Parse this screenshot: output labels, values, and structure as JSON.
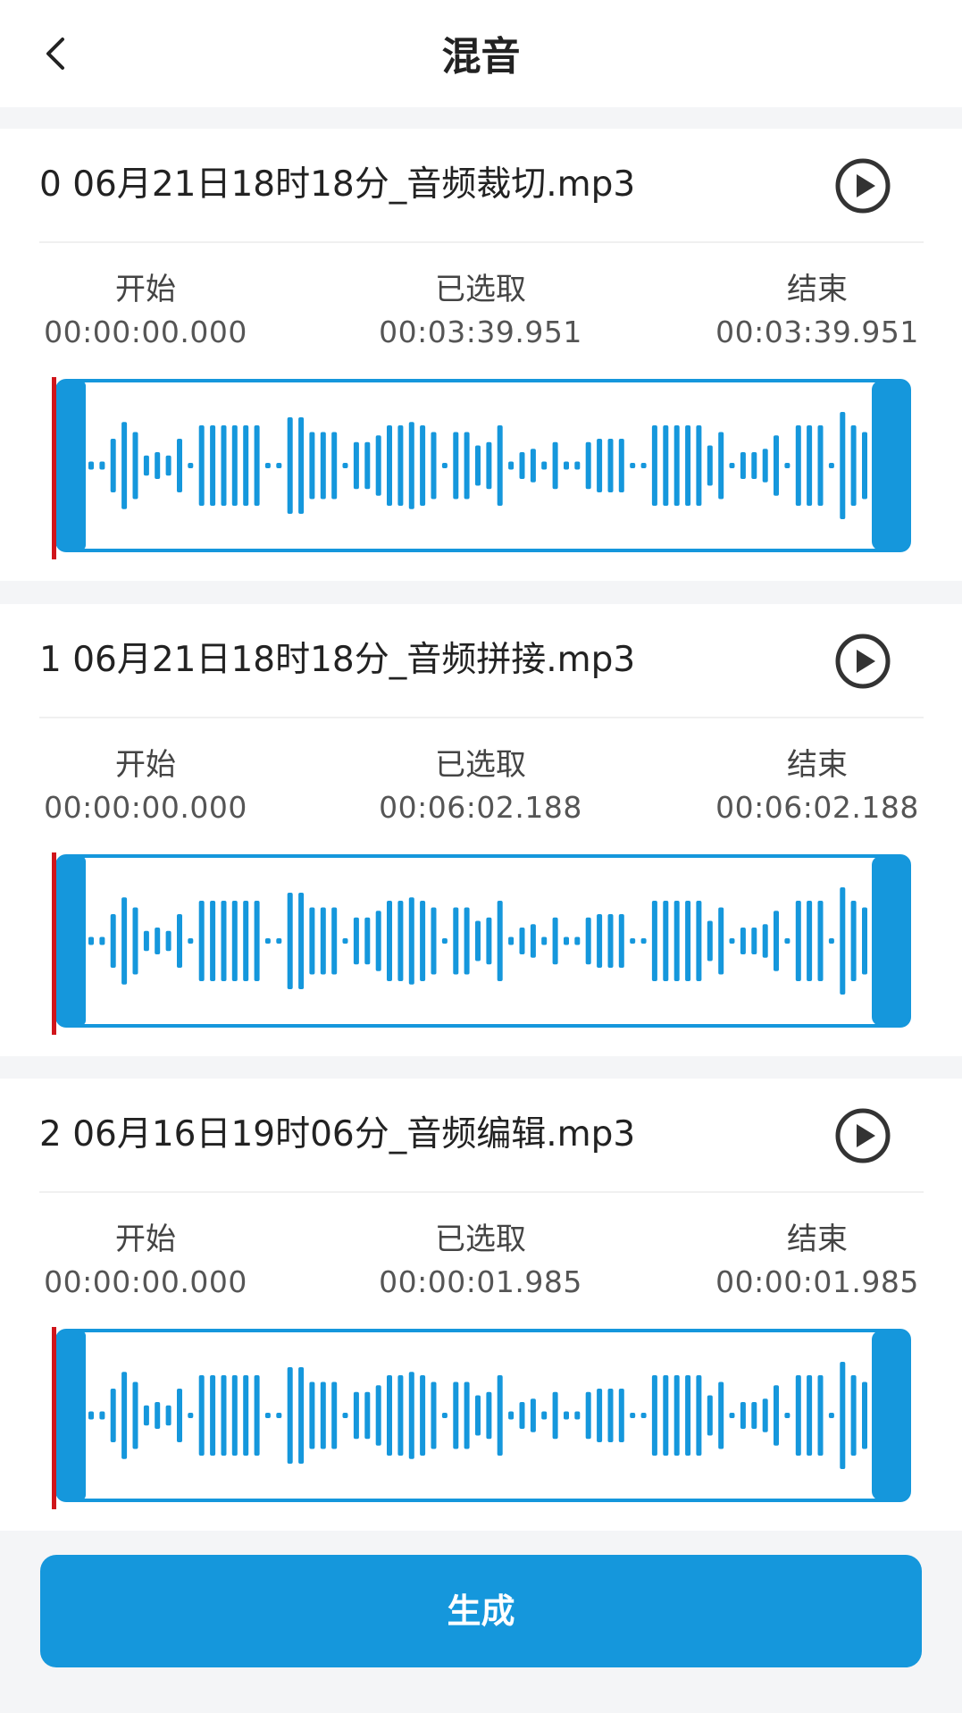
{
  "header": {
    "title": "混音",
    "back_icon": "chevron-left-icon"
  },
  "labels": {
    "start": "开始",
    "selected": "已选取",
    "end": "结束"
  },
  "tracks": [
    {
      "name": "0  06月21日18时18分_音频裁切.mp3",
      "start": "00:00:00.000",
      "selected": "00:03:39.951",
      "end": "00:03:39.951"
    },
    {
      "name": "1  06月21日18时18分_音频拼接.mp3",
      "start": "00:00:00.000",
      "selected": "00:06:02.188",
      "end": "00:06:02.188"
    },
    {
      "name": "2  06月16日19时06分_音频编辑.mp3",
      "start": "00:00:00.000",
      "selected": "00:00:01.985",
      "end": "00:00:01.985"
    }
  ],
  "footer": {
    "generate_label": "生成"
  },
  "colors": {
    "accent": "#1597dc",
    "playhead": "#d0151b",
    "page_background": "#f4f5f7",
    "card_background": "#ffffff"
  }
}
